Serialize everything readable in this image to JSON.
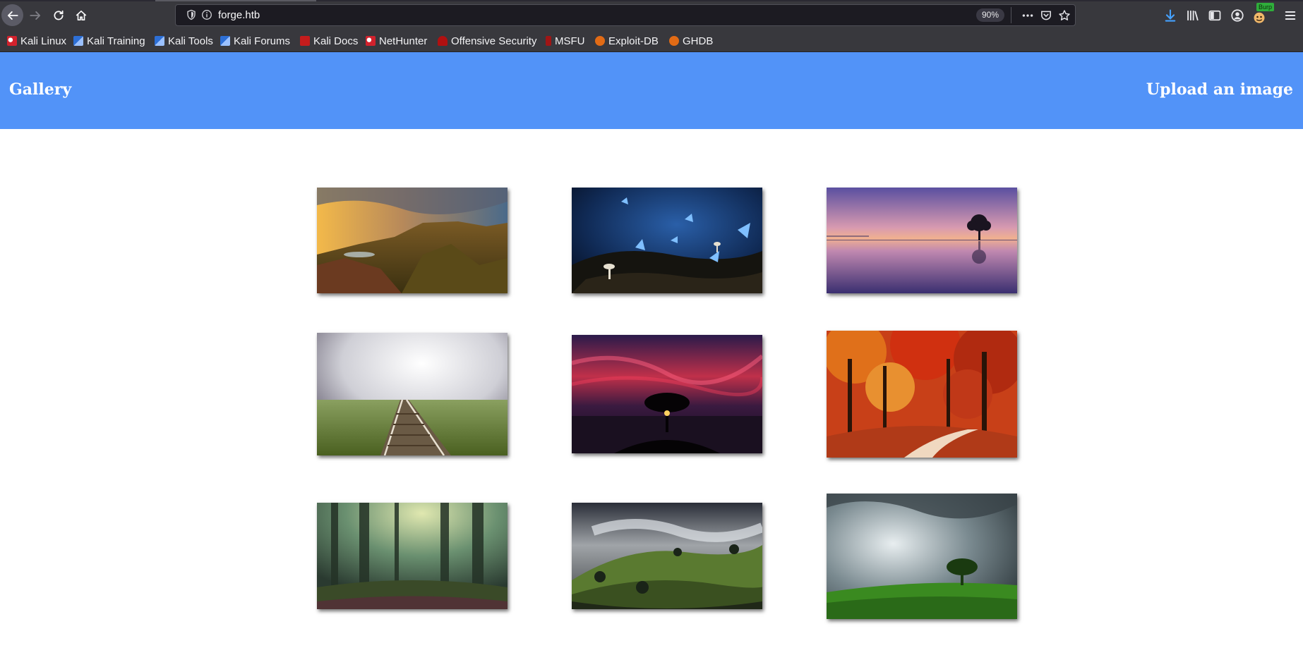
{
  "browser": {
    "url": "forge.htb",
    "zoom": "90%",
    "burp_badge": "Burp",
    "bookmarks": [
      {
        "label": "Kali Linux",
        "icon": "kali-icon"
      },
      {
        "label": "Kali Training",
        "icon": "kali-training-icon"
      },
      {
        "label": "Kali Tools",
        "icon": "kali-tools-icon"
      },
      {
        "label": "Kali Forums",
        "icon": "kali-forums-icon"
      },
      {
        "label": "Kali Docs",
        "icon": "kali-docs-icon"
      },
      {
        "label": "NetHunter",
        "icon": "nethunter-icon"
      },
      {
        "label": "Offensive Security",
        "icon": "offsec-icon"
      },
      {
        "label": "MSFU",
        "icon": "msfu-icon"
      },
      {
        "label": "Exploit-DB",
        "icon": "exploit-db-icon"
      },
      {
        "label": "GHDB",
        "icon": "ghdb-icon"
      }
    ]
  },
  "header": {
    "brand": "Gallery",
    "upload_link": "Upload an image",
    "background": "#5293f8"
  },
  "gallery": {
    "images": [
      {
        "subject": "mountain landscape at sunset"
      },
      {
        "subject": "blue butterflies in a dark forest"
      },
      {
        "subject": "lone tree in a lake at dusk"
      },
      {
        "subject": "railway track under a cloudy sky"
      },
      {
        "subject": "tree silhouette against a red sky"
      },
      {
        "subject": "autumn forest path"
      },
      {
        "subject": "misty green forest"
      },
      {
        "subject": "hillside village with clouds"
      },
      {
        "subject": "lone tree on a green hill under storm clouds"
      }
    ]
  }
}
